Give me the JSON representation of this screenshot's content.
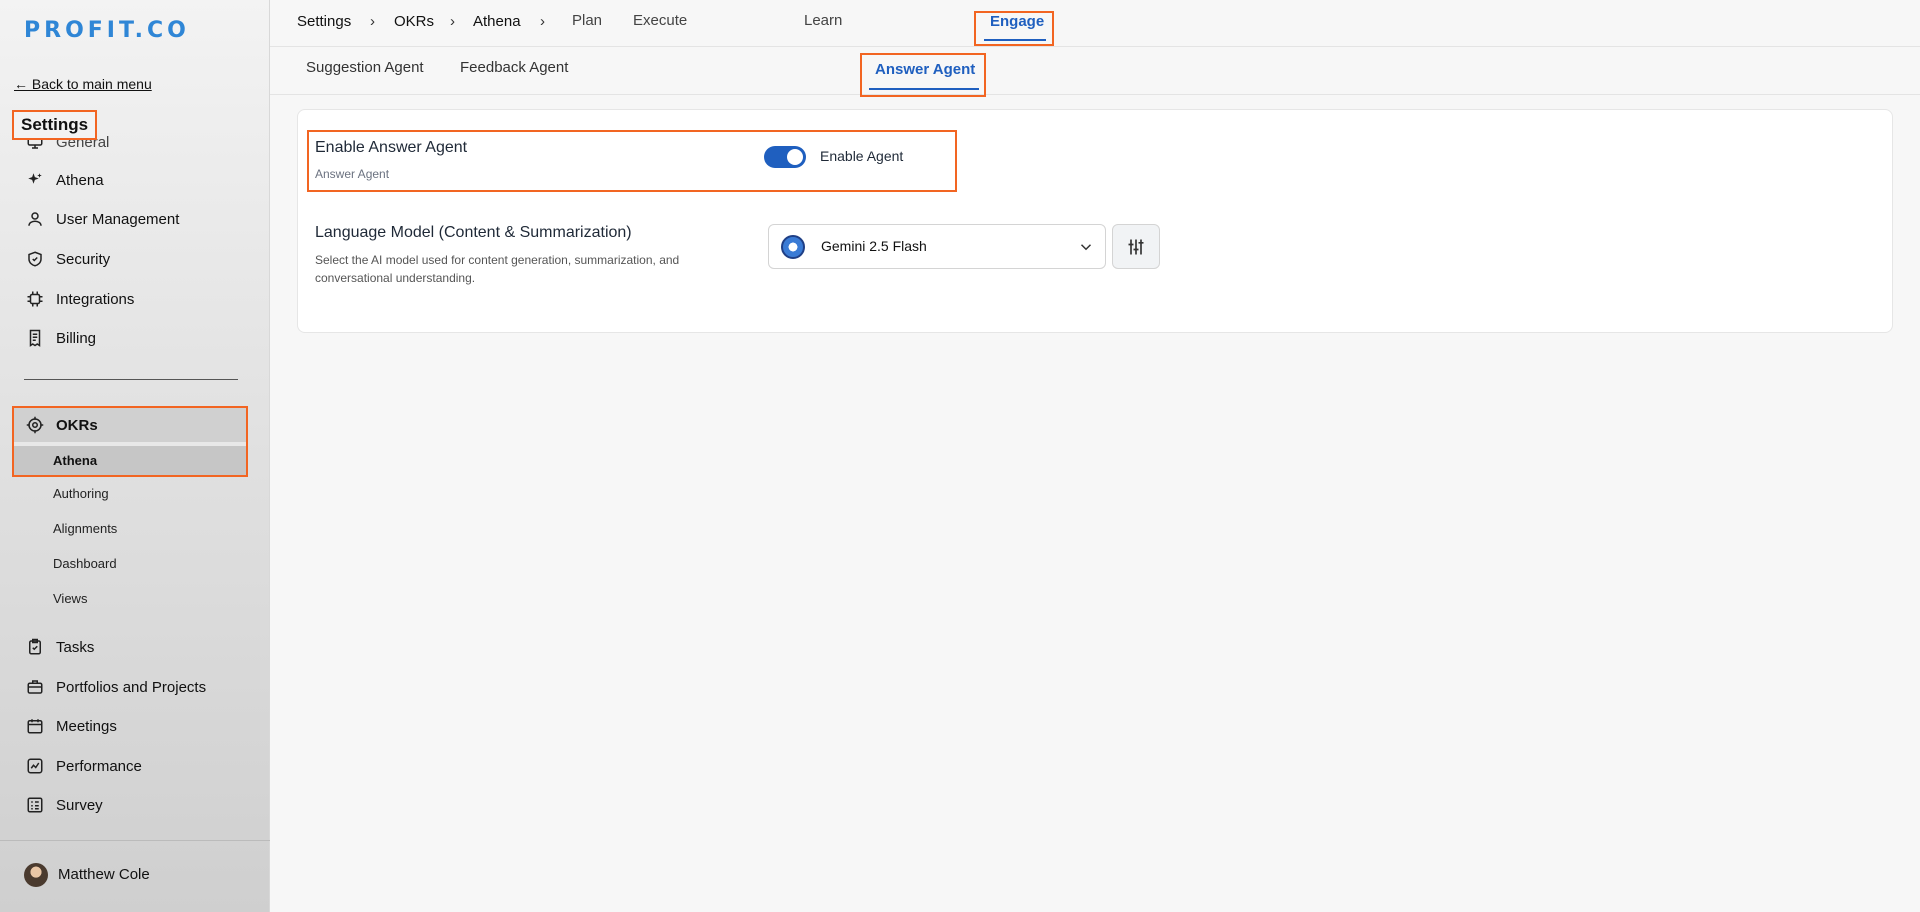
{
  "brand": {
    "logo_text": "PROFIT.CO",
    "accent_color": "#1f5fbf",
    "highlight_color": "#f26522"
  },
  "sidebar": {
    "back_link": "← Back to main menu",
    "title": "Settings",
    "items": [
      {
        "label": "General",
        "icon": "monitor-icon"
      },
      {
        "label": "Athena",
        "icon": "sparkle-icon"
      },
      {
        "label": "User Management",
        "icon": "user-icon"
      },
      {
        "label": "Security",
        "icon": "shield-icon"
      },
      {
        "label": "Integrations",
        "icon": "chip-icon"
      },
      {
        "label": "Billing",
        "icon": "receipt-icon"
      }
    ],
    "okrs": {
      "label": "OKRs",
      "icon": "target-icon",
      "active_sub": "Athena",
      "sub_items": [
        "Authoring",
        "Alignments",
        "Dashboard",
        "Views"
      ]
    },
    "modules": [
      {
        "label": "Tasks",
        "icon": "clipboard-check-icon"
      },
      {
        "label": "Portfolios and Projects",
        "icon": "briefcase-icon"
      },
      {
        "label": "Meetings",
        "icon": "calendar-icon"
      },
      {
        "label": "Performance",
        "icon": "trend-chart-icon"
      },
      {
        "label": "Survey",
        "icon": "survey-list-icon"
      }
    ],
    "user": {
      "name": "Matthew Cole"
    }
  },
  "topbar": {
    "breadcrumbs": [
      "Settings",
      "OKRs",
      "Athena"
    ],
    "separator": "›",
    "tabs": [
      "Plan",
      "Execute",
      "Engage",
      "Learn"
    ],
    "active_tab": "Engage"
  },
  "subtabs": {
    "tabs": [
      "Suggestion Agent",
      "Feedback Agent",
      "Answer Agent"
    ],
    "active_tab": "Answer Agent"
  },
  "content": {
    "enable": {
      "title": "Enable Answer Agent",
      "subtitle": "Answer Agent",
      "toggle_label": "Enable Agent",
      "toggle_on": true
    },
    "language_model": {
      "title": "Language Model (Content & Summarization)",
      "description": "Select the AI model used for content generation, summarization, and conversational understanding.",
      "selected": "Gemini 2.5 Flash"
    }
  }
}
